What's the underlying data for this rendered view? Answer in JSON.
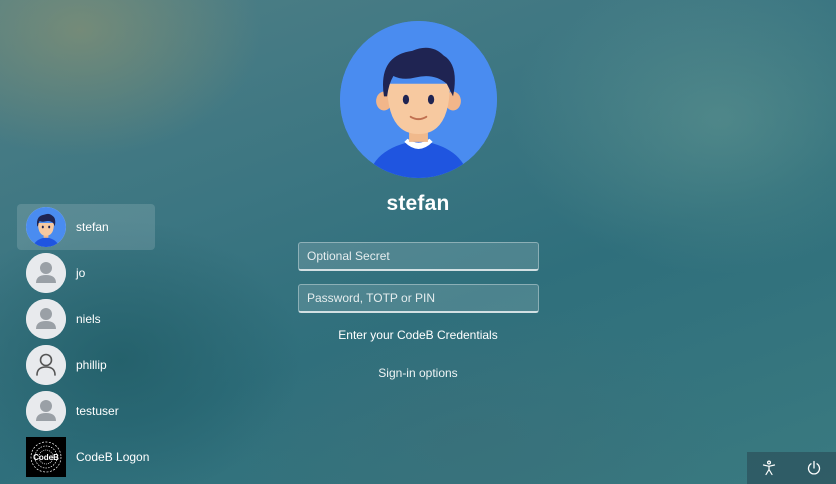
{
  "current_user": {
    "name": "stefan",
    "avatar_icon": "cartoon-boy-avatar"
  },
  "form": {
    "secret_placeholder": "Optional Secret",
    "password_placeholder": "Password, TOTP or PIN",
    "credentials_text": "Enter your CodeB Credentials",
    "signin_options": "Sign-in options"
  },
  "users": [
    {
      "label": "stefan",
      "icon": "cartoon-boy-avatar",
      "selected": true
    },
    {
      "label": "jo",
      "icon": "default-user-avatar"
    },
    {
      "label": "niels",
      "icon": "default-user-avatar"
    },
    {
      "label": "phillip",
      "icon": "outline-user-avatar"
    },
    {
      "label": "testuser",
      "icon": "default-user-avatar"
    },
    {
      "label": "CodeB Logon",
      "icon": "codeb-logo",
      "logo_text": "CodeB"
    }
  ],
  "tray": {
    "accessibility_icon": "accessibility-icon",
    "power_icon": "power-icon"
  },
  "colors": {
    "avatar_blue": "#4a8cf0",
    "hair": "#1f2452",
    "skin": "#f7c9a0"
  }
}
